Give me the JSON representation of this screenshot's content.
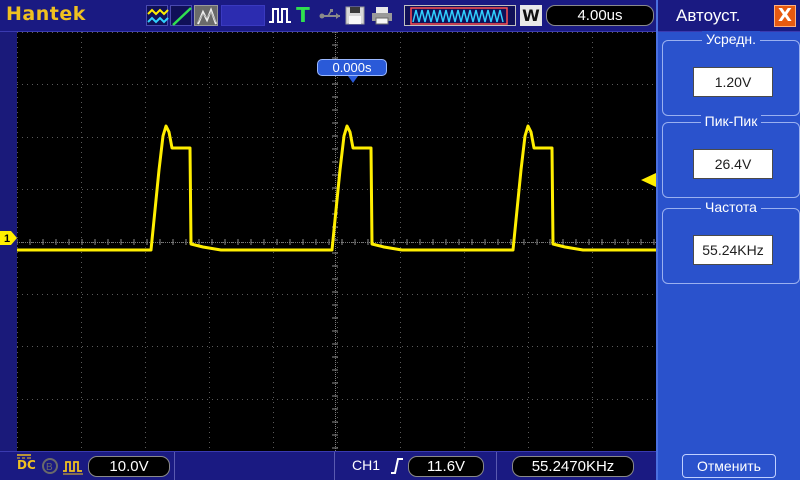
{
  "topbar": {
    "brand": "Hantek",
    "trigger_mode_letter": "T",
    "wave_mode_letter": "W",
    "timebase": "4.00us"
  },
  "screen": {
    "trigger_position": "0.000s",
    "channel_marker": "1"
  },
  "panel": {
    "title": "Автоуст.",
    "close_label": "X",
    "measurements": [
      {
        "label": "Усредн.",
        "value": "1.20V"
      },
      {
        "label": "Пик-Пик",
        "value": "26.4V"
      },
      {
        "label": "Частота",
        "value": "55.24KHz"
      }
    ],
    "cancel_label": "Отменить"
  },
  "bottombar": {
    "coupling": "DC",
    "volts_per_div": "10.0V",
    "trigger_source": "CH1",
    "trigger_level": "11.6V",
    "frequency": "55.2470KHz"
  },
  "colors": {
    "trace": "#ffee00",
    "brand": "#f0c020",
    "panel_bg": "#2a52cc",
    "bar_bg": "#1a1a82",
    "close_button": "#e85a10"
  },
  "icons": [
    "acquire-mode-icon",
    "ramp-icon",
    "persistence-icon",
    "pulse-icon",
    "trigger-mode-icon",
    "usb-icon",
    "save-icon",
    "print-icon",
    "wave-overview-icon",
    "wave-mode-icon",
    "dc-coupling-icon",
    "bandwidth-limit-icon",
    "probe-icon",
    "rising-edge-icon",
    "channel-1-marker-icon",
    "trigger-level-icon"
  ]
}
